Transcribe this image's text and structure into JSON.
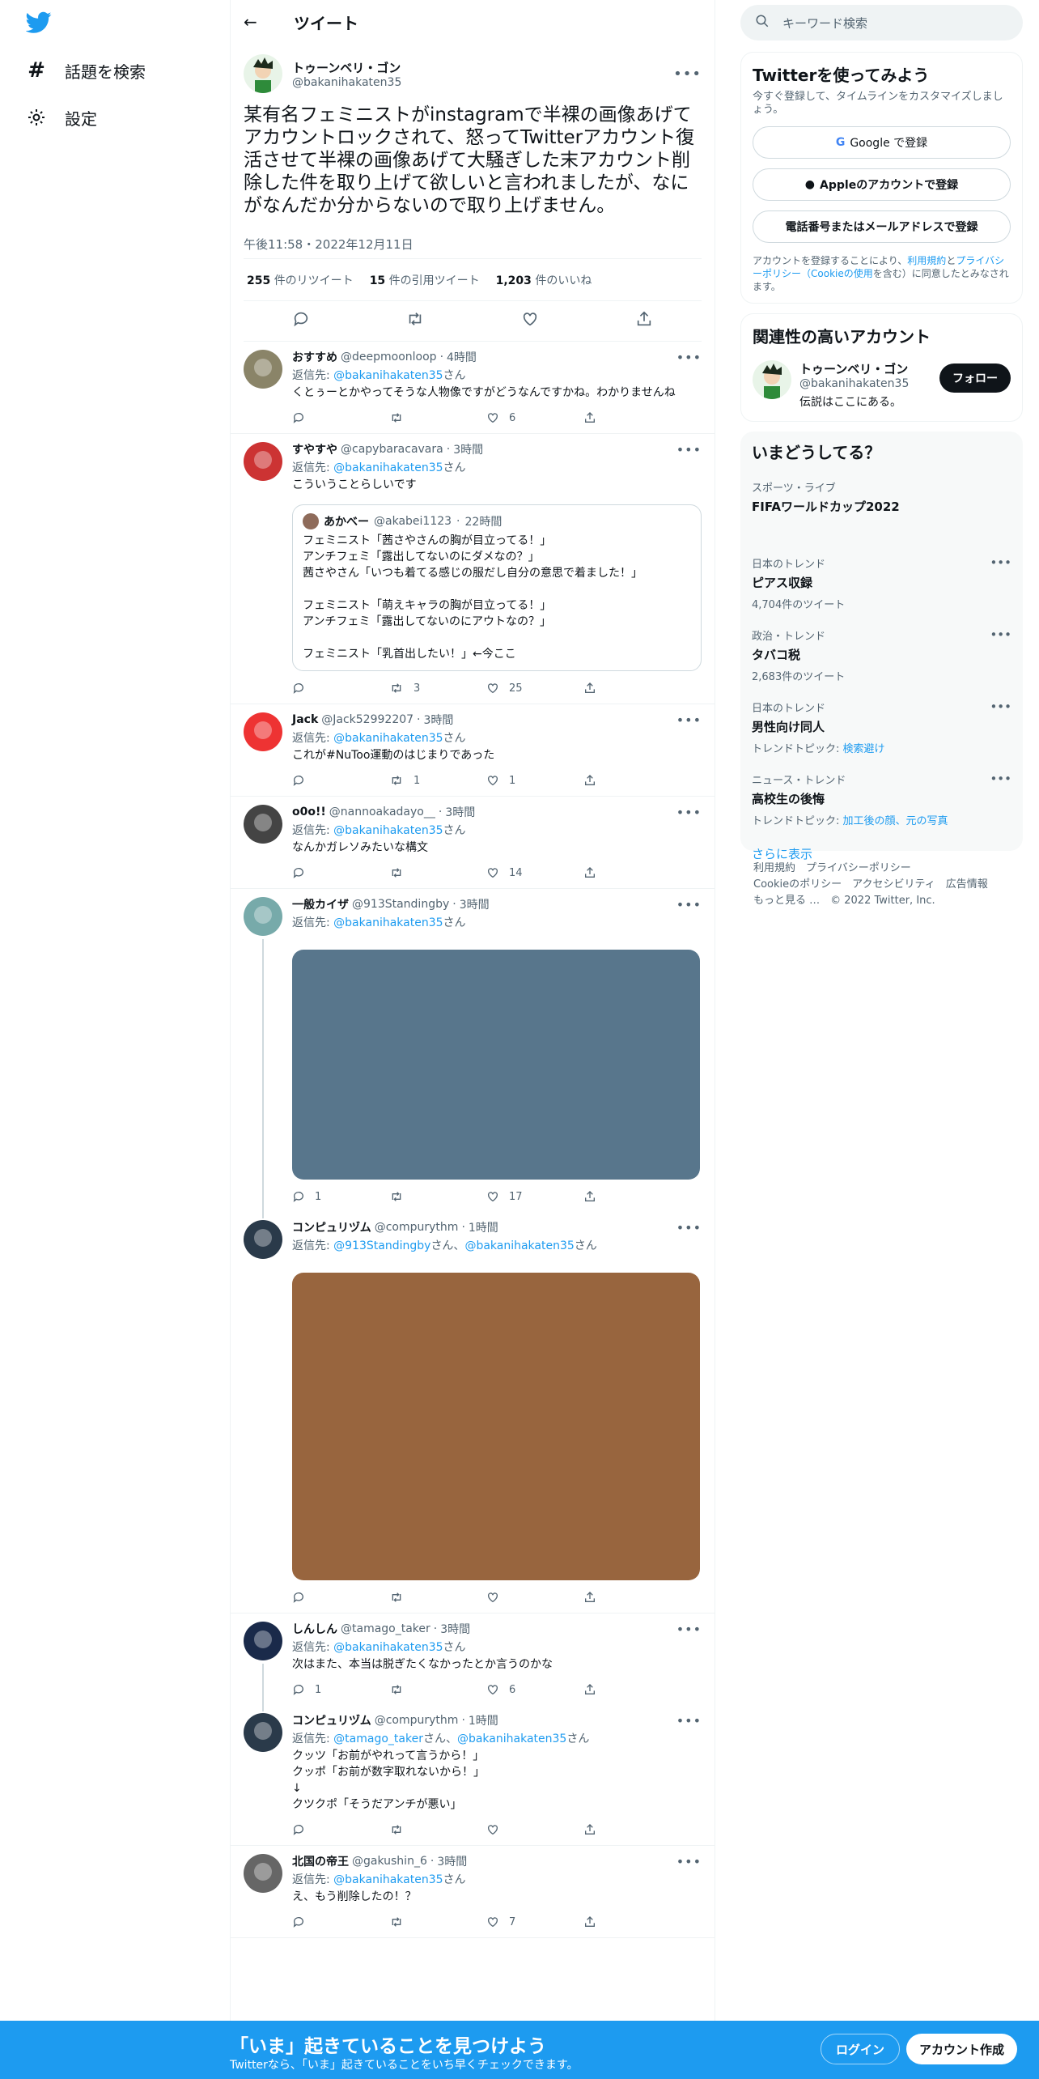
{
  "nav": {
    "explore_label": "話題を検索",
    "settings_label": "設定"
  },
  "header": {
    "title": "ツイート"
  },
  "main_tweet": {
    "name": "トゥーンベリ・ゴン",
    "handle": "@bakanihakaten35",
    "text": "某有名フェミニストがinstagramで半裸の画像あげてアカウントロックされて、怒ってTwitterアカウント復活させて半裸の画像あげて大騒ぎした末アカウント削除した件を取り上げて欲しいと言われましたが、なにがなんだか分からないので取り上げません。",
    "time": "午後11:58・2022年12月11日",
    "retweets": "255",
    "retweets_label": "件のリツイート",
    "quotes": "15",
    "quotes_label": "件の引用ツイート",
    "likes": "1,203",
    "likes_label": "件のいいね"
  },
  "replies": [
    {
      "name": "おすすめ",
      "handle": "@deepmoonloop",
      "time": "4時間",
      "reply_prefix": "返信先: ",
      "reply_to": "@bakanihakaten35",
      "reply_suffix": "さん",
      "text": "くとぅーとかやってそうな人物像ですがどうなんですかね。わかりませんね",
      "replies": "",
      "retweets": "",
      "likes": "6"
    },
    {
      "name": "すやすや",
      "handle": "@capybaracavara",
      "time": "3時間",
      "reply_prefix": "返信先: ",
      "reply_to": "@bakanihakaten35",
      "reply_suffix": "さん",
      "text": "こういうことらしいです",
      "replies": "",
      "retweets": "3",
      "likes": "25",
      "quote": {
        "name": "あかべー",
        "handle": "@akabei1123",
        "time": "22時間",
        "text": "フェミニスト「茜さやさんの胸が目立ってる！」\nアンチフェミ「露出してないのにダメなの？」\n茜さやさん「いつも着てる感じの服だし自分の意思で着ました！」\n\nフェミニスト「萌えキャラの胸が目立ってる！」\nアンチフェミ「露出してないのにアウトなの？」\n\nフェミニスト「乳首出したい！」←今ここ"
      }
    },
    {
      "name": "Jack",
      "handle": "@Jack52992207",
      "time": "3時間",
      "reply_prefix": "返信先: ",
      "reply_to": "@bakanihakaten35",
      "reply_suffix": "さん",
      "text": "これが#NuToo運動のはじまりであった",
      "replies": "",
      "retweets": "1",
      "likes": "1"
    },
    {
      "name": "o0o!!",
      "handle": "@nannoakadayo__",
      "time": "3時間",
      "reply_prefix": "返信先: ",
      "reply_to": "@bakanihakaten35",
      "reply_suffix": "さん",
      "text": "なんかガレソみたいな構文",
      "replies": "",
      "retweets": "",
      "likes": "14"
    },
    {
      "name": "一般カイザ",
      "handle": "@913Standingby",
      "time": "3時間",
      "reply_prefix": "返信先: ",
      "reply_to": "@bakanihakaten35",
      "reply_suffix": "さん",
      "text": "",
      "replies": "1",
      "retweets": "",
      "likes": "17",
      "media_color": "#58768c"
    },
    {
      "name": "コンピュリヅム",
      "handle": "@compurythm",
      "time": "1時間",
      "reply_prefix": "返信先: ",
      "reply_to": "@913Standingby",
      "reply_mid": "さん、",
      "reply_to2": "@bakanihakaten35",
      "reply_suffix": "さん",
      "text": "",
      "replies": "",
      "retweets": "",
      "likes": "",
      "media_color": "#98653e"
    },
    {
      "name": "しんしん",
      "handle": "@tamago_taker",
      "time": "3時間",
      "reply_prefix": "返信先: ",
      "reply_to": "@bakanihakaten35",
      "reply_suffix": "さん",
      "text": "次はまた、本当は脱ぎたくなかったとか言うのかな",
      "replies": "1",
      "retweets": "",
      "likes": "6"
    },
    {
      "name": "コンピュリヅム",
      "handle": "@compurythm",
      "time": "1時間",
      "reply_prefix": "返信先: ",
      "reply_to": "@tamago_taker",
      "reply_mid": "さん、",
      "reply_to2": "@bakanihakaten35",
      "reply_suffix": "さん",
      "text": "クッツ「お前がやれって言うから！」\nクッポ「お前が数字取れないから！」\n↓\nクツクポ「そうだアンチが悪い」",
      "replies": "",
      "retweets": "",
      "likes": ""
    },
    {
      "name": "北国の帝王",
      "handle": "@gakushin_6",
      "time": "3時間",
      "reply_prefix": "返信先: ",
      "reply_to": "@bakanihakaten35",
      "reply_suffix": "さん",
      "text": "え、もう削除したの！？",
      "replies": "",
      "retweets": "",
      "likes": "7"
    }
  ],
  "sidebar": {
    "search_placeholder": "キーワード検索",
    "signup": {
      "title": "Twitterを使ってみよう",
      "subtitle": "今すぐ登録して、タイムラインをカスタマイズしましょう。",
      "google_label": "Google で登録",
      "apple_label": "Appleのアカウントで登録",
      "phone_label": "電話番号またはメールアドレスで登録",
      "legal_prefix": "アカウントを登録することにより、",
      "terms": "利用規約",
      "and": "と",
      "privacy": "プライバシーポリシー（Cookieの使用",
      "legal_suffix": "を含む）に同意したとみなされます。"
    },
    "related": {
      "title": "関連性の高いアカウント",
      "name": "トゥーンベリ・ゴン",
      "handle": "@bakanihakaten35",
      "bio": "伝説はここにある。",
      "follow_label": "フォロー"
    },
    "trends": {
      "title": "いまどうしてる？",
      "items": [
        {
          "category": "スポーツ・ライブ",
          "name": "FIFAワールドカップ2022",
          "extra": "",
          "extra_link": ""
        },
        {
          "category": "日本のトレンド",
          "name": "ピアス収録",
          "extra": "4,704件のツイート",
          "extra_link": ""
        },
        {
          "category": "政治・トレンド",
          "name": "タバコ税",
          "extra": "2,683件のツイート",
          "extra_link": ""
        },
        {
          "category": "日本のトレンド",
          "name": "男性向け同人",
          "extra": "トレンドトピック: ",
          "extra_link": "検索避け"
        },
        {
          "category": "ニュース・トレンド",
          "name": "高校生の後悔",
          "extra": "トレンドトピック: ",
          "extra_link": "加工後の顔、元の写真"
        }
      ],
      "show_more": "さらに表示"
    },
    "footer": {
      "line1": "利用規約　プライバシーポリシー",
      "line2": "Cookieのポリシー　アクセシビリティ　広告情報",
      "line3": "もっと見る …　© 2022 Twitter, Inc."
    }
  },
  "bottom_bar": {
    "title": "「いま」起きていることを見つけよう",
    "subtitle": "Twitterなら、「いま」起きていることをいち早くチェックできます。",
    "login_label": "ログイン",
    "signup_label": "アカウント作成"
  },
  "colors": {
    "accent": "#1d9bf0",
    "text": "#0f1419",
    "muted": "#536471"
  }
}
